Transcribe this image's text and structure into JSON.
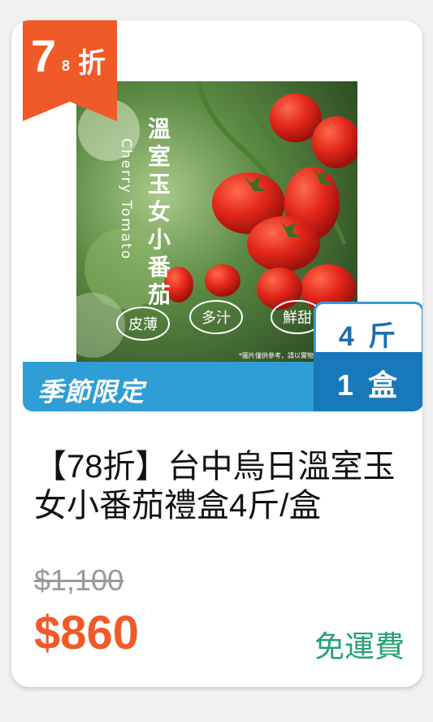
{
  "discount_badge": {
    "number": "7",
    "small": "8",
    "unit": "折"
  },
  "image": {
    "vertical_title": "溫室玉女小番茄",
    "vertical_en": "Cherry Tomato",
    "tags": [
      "皮薄",
      "多汁",
      "鮮甜"
    ],
    "caption": "*圖片僅供參考，請以實物為準"
  },
  "season_label": "季節限定",
  "spec": {
    "weight": "4 斤",
    "unit": "1 盒"
  },
  "product": {
    "title": "【78折】台中烏日溫室玉女小番茄禮盒4斤/盒"
  },
  "price": {
    "original": "$1,100",
    "sale": "$860"
  },
  "shipping": "免運費",
  "colors": {
    "badge": "#f05a28",
    "season_bar": "#2f9ed7",
    "spec_dark": "#1779ba",
    "sale_price": "#f05a28",
    "shipping": "#24a373"
  }
}
